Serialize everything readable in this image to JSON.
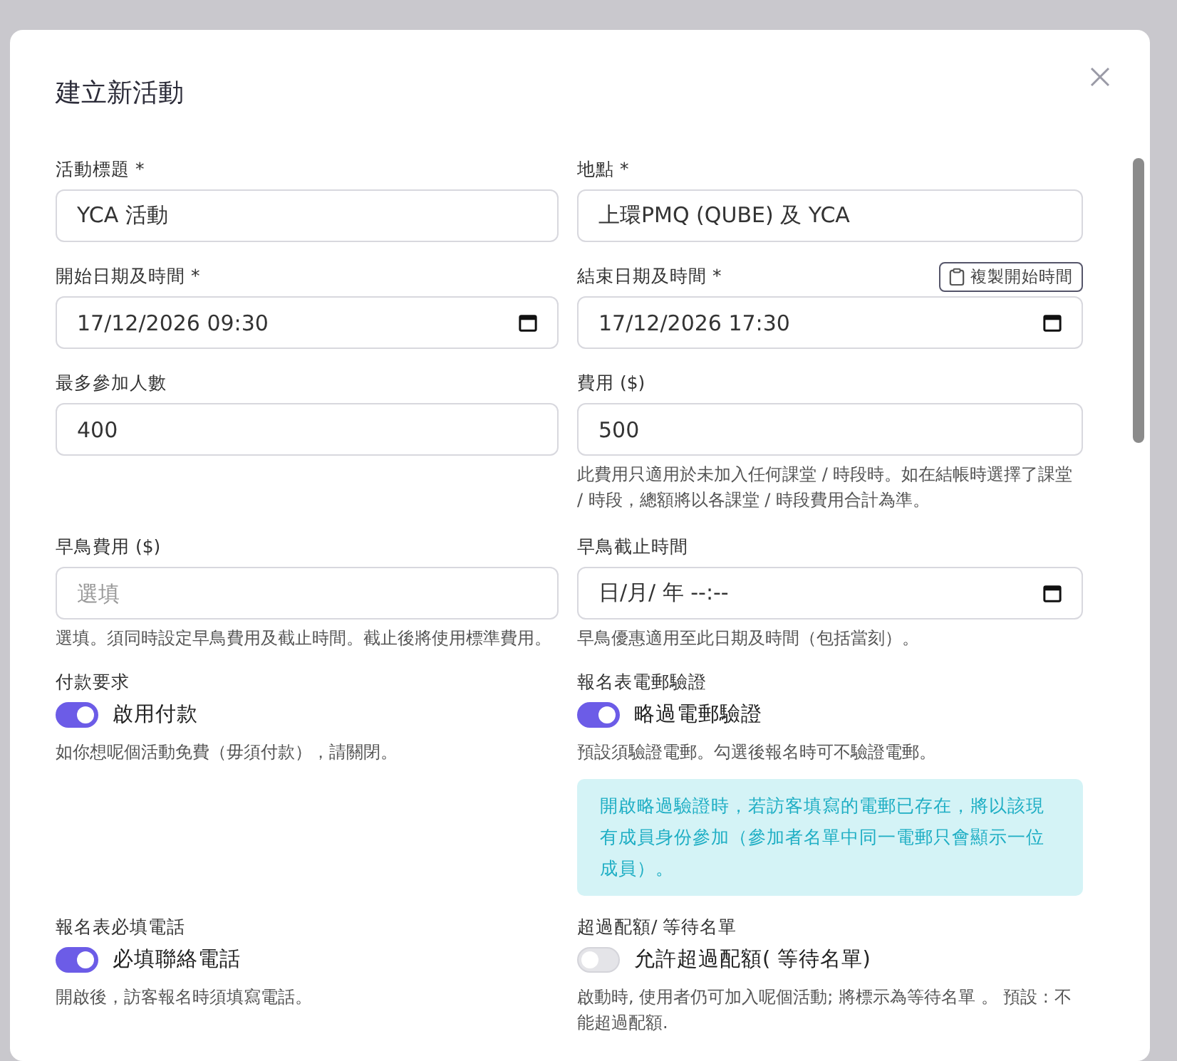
{
  "dialog": {
    "title": "建立新活動"
  },
  "fields": [
    {
      "kind": "text",
      "label": "活動標題 *",
      "value": "YCA 活動"
    },
    {
      "kind": "text",
      "label": "地點 *",
      "value": "上環PMQ (QUBE) 及 YCA"
    },
    {
      "kind": "datetime",
      "label": "開始日期及時間 *",
      "value": "17/12/2026 09:30"
    },
    {
      "kind": "datetime",
      "label": "結束日期及時間 *",
      "value": "17/12/2026 17:30",
      "action": "複製開始時間"
    },
    {
      "kind": "text",
      "label": "最多參加人數",
      "value": "400"
    },
    {
      "kind": "text",
      "label": "費用 ($)",
      "value": "500",
      "help": "此費用只適用於未加入任何課堂 / 時段時。如在結帳時選擇了課堂 / 時段，總額將以各課堂 / 時段費用合計為準。"
    },
    {
      "kind": "text",
      "label": "早鳥費用 ($)",
      "placeholder": "選填",
      "help": "選填。須同時設定早鳥費用及截止時間。截止後將使用標準費用。"
    },
    {
      "kind": "datetime",
      "label": "早鳥截止時間",
      "value": "日/月/ 年 --:--",
      "help": "早鳥優惠適用至此日期及時間（包括當刻）。"
    }
  ],
  "toggles": [
    {
      "label": "付款要求",
      "toggle_label": "啟用付款",
      "on": true,
      "help": "如你想呢個活動免費（毋須付款），請關閉。"
    },
    {
      "label": "報名表電郵驗證",
      "toggle_label": "略過電郵驗證",
      "on": true,
      "help": "預設須驗證電郵。勾選後報名時可不驗證電郵。",
      "note": "開啟略過驗證時，若訪客填寫的電郵已存在，將以該現有成員身份參加（參加者名單中同一電郵只會顯示一位成員）。"
    },
    {
      "label": "報名表必填電話",
      "toggle_label": "必填聯絡電話",
      "on": true,
      "help": "開啟後，訪客報名時須填寫電話。"
    },
    {
      "label": "超過配額/ 等待名單",
      "toggle_label": "允許超過配額( 等待名單)",
      "on": false,
      "help": "啟動時, 使用者仍可加入呢個活動; 將標示為等待名單 。 預設 : 不能超過配額."
    }
  ]
}
